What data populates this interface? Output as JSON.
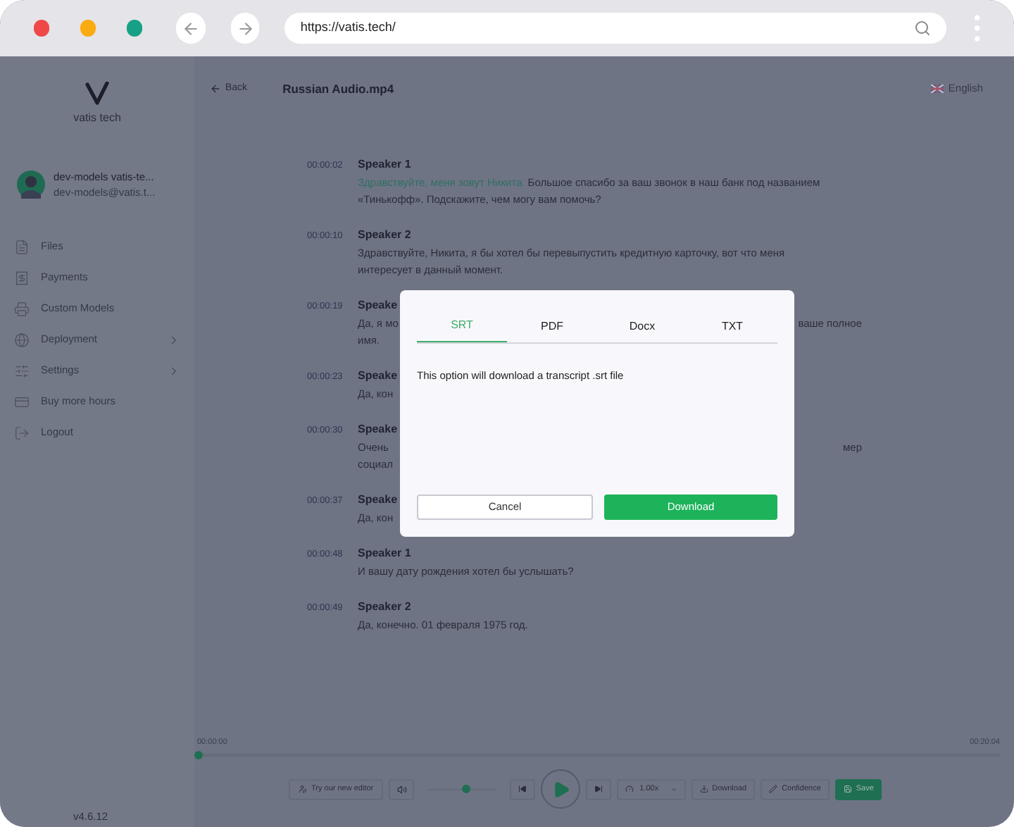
{
  "browser": {
    "url": "https://vatis.tech/"
  },
  "sidebar": {
    "logo_text": "vatis tech",
    "user": {
      "name": "dev-models vatis-te...",
      "email": "dev-models@vatis.t..."
    },
    "items": [
      {
        "label": "Files",
        "chevron": false
      },
      {
        "label": "Payments",
        "chevron": false
      },
      {
        "label": "Custom Models",
        "chevron": false
      },
      {
        "label": "Deployment",
        "chevron": true
      },
      {
        "label": "Settings",
        "chevron": true
      },
      {
        "label": "Buy more hours",
        "chevron": false
      },
      {
        "label": "Logout",
        "chevron": false
      }
    ],
    "version": "v4.6.12"
  },
  "header": {
    "back": "Back",
    "title": "Russian Audio.mp4",
    "language": "English"
  },
  "transcript": [
    {
      "time": "00:00:02",
      "speaker": "Speaker 1",
      "lines": [
        [
          {
            "highlighted": "Здравствуйте, меня зовут Никита.",
            "text": " Большое спасибо за ваш звонок в наш банк под названием"
          }
        ],
        [
          {
            "text": "«Тинькофф». Подскажите, чем могу вам помочь?"
          }
        ]
      ]
    },
    {
      "time": "00:00:10",
      "speaker": "Speaker 2",
      "lines": [
        [
          {
            "text": "Здравствуйте, Никита, я бы хотел бы перевыпустить кредитную карточку, вот что меня"
          }
        ],
        [
          {
            "text": "интересует в данный момент."
          }
        ]
      ]
    },
    {
      "time": "00:00:19",
      "speaker": "Speake",
      "lines": [
        [
          {
            "text": "Да, я мо"
          },
          {
            "text": "ваше полное"
          }
        ],
        [
          {
            "text": "имя."
          }
        ]
      ]
    },
    {
      "time": "00:00:23",
      "speaker": "Speake",
      "lines": [
        [
          {
            "text": "Да, кон"
          }
        ]
      ]
    },
    {
      "time": "00:00:30",
      "speaker": "Speake",
      "lines": [
        [
          {
            "text": "Очень"
          },
          {
            "text": "мер"
          }
        ],
        [
          {
            "text": "социал"
          }
        ]
      ]
    },
    {
      "time": "00:00:37",
      "speaker": "Speake",
      "lines": [
        [
          {
            "text": "Да, кон"
          }
        ]
      ]
    },
    {
      "time": "00:00:48",
      "speaker": "Speaker 1",
      "lines": [
        [
          {
            "text": "И вашу дату рождения хотел бы услышать?"
          }
        ]
      ]
    },
    {
      "time": "00:00:49",
      "speaker": "Speaker 2",
      "lines": [
        [
          {
            "text": "Да, конечно. 01 февраля 1975 год."
          }
        ]
      ]
    }
  ],
  "player": {
    "current_time": "00:00:00",
    "total_time": "00:20:04",
    "progress": {
      "level": 0
    },
    "editor_button": "Try our new editor",
    "volume": {
      "level": 0.55
    },
    "speed": "1.00x",
    "download": "Download",
    "confidence": "Confidence",
    "save": "Save"
  },
  "dialog": {
    "tabs": [
      {
        "label": "SRT",
        "selected": true
      },
      {
        "label": "PDF",
        "selected": false
      },
      {
        "label": "Docx",
        "selected": false
      },
      {
        "label": "TXT",
        "selected": false
      }
    ],
    "message": "This option will download a transcript .srt file",
    "cancel": "Cancel",
    "confirm": "Download"
  }
}
